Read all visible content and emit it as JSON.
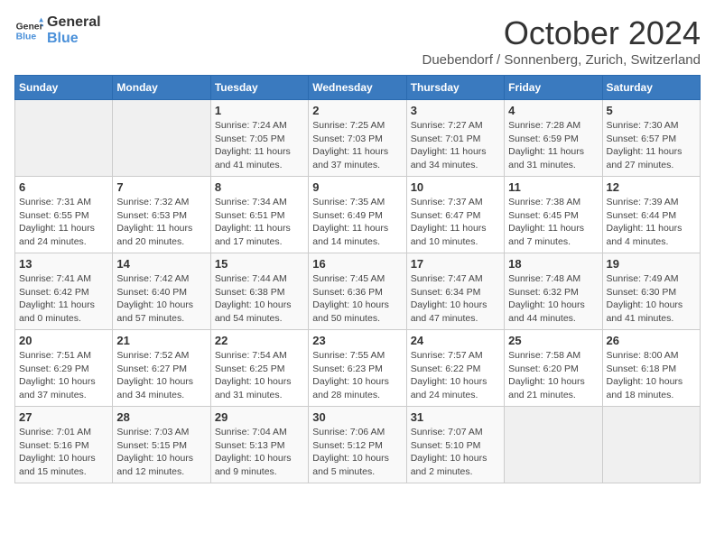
{
  "header": {
    "logo_general": "General",
    "logo_blue": "Blue",
    "title": "October 2024",
    "location": "Duebendorf / Sonnenberg, Zurich, Switzerland"
  },
  "weekdays": [
    "Sunday",
    "Monday",
    "Tuesday",
    "Wednesday",
    "Thursday",
    "Friday",
    "Saturday"
  ],
  "weeks": [
    [
      {
        "day": "",
        "empty": true
      },
      {
        "day": "",
        "empty": true
      },
      {
        "day": "1",
        "sunrise": "7:24 AM",
        "sunset": "7:05 PM",
        "daylight": "11 hours and 41 minutes."
      },
      {
        "day": "2",
        "sunrise": "7:25 AM",
        "sunset": "7:03 PM",
        "daylight": "11 hours and 37 minutes."
      },
      {
        "day": "3",
        "sunrise": "7:27 AM",
        "sunset": "7:01 PM",
        "daylight": "11 hours and 34 minutes."
      },
      {
        "day": "4",
        "sunrise": "7:28 AM",
        "sunset": "6:59 PM",
        "daylight": "11 hours and 31 minutes."
      },
      {
        "day": "5",
        "sunrise": "7:30 AM",
        "sunset": "6:57 PM",
        "daylight": "11 hours and 27 minutes."
      }
    ],
    [
      {
        "day": "6",
        "sunrise": "7:31 AM",
        "sunset": "6:55 PM",
        "daylight": "11 hours and 24 minutes."
      },
      {
        "day": "7",
        "sunrise": "7:32 AM",
        "sunset": "6:53 PM",
        "daylight": "11 hours and 20 minutes."
      },
      {
        "day": "8",
        "sunrise": "7:34 AM",
        "sunset": "6:51 PM",
        "daylight": "11 hours and 17 minutes."
      },
      {
        "day": "9",
        "sunrise": "7:35 AM",
        "sunset": "6:49 PM",
        "daylight": "11 hours and 14 minutes."
      },
      {
        "day": "10",
        "sunrise": "7:37 AM",
        "sunset": "6:47 PM",
        "daylight": "11 hours and 10 minutes."
      },
      {
        "day": "11",
        "sunrise": "7:38 AM",
        "sunset": "6:45 PM",
        "daylight": "11 hours and 7 minutes."
      },
      {
        "day": "12",
        "sunrise": "7:39 AM",
        "sunset": "6:44 PM",
        "daylight": "11 hours and 4 minutes."
      }
    ],
    [
      {
        "day": "13",
        "sunrise": "7:41 AM",
        "sunset": "6:42 PM",
        "daylight": "11 hours and 0 minutes."
      },
      {
        "day": "14",
        "sunrise": "7:42 AM",
        "sunset": "6:40 PM",
        "daylight": "10 hours and 57 minutes."
      },
      {
        "day": "15",
        "sunrise": "7:44 AM",
        "sunset": "6:38 PM",
        "daylight": "10 hours and 54 minutes."
      },
      {
        "day": "16",
        "sunrise": "7:45 AM",
        "sunset": "6:36 PM",
        "daylight": "10 hours and 50 minutes."
      },
      {
        "day": "17",
        "sunrise": "7:47 AM",
        "sunset": "6:34 PM",
        "daylight": "10 hours and 47 minutes."
      },
      {
        "day": "18",
        "sunrise": "7:48 AM",
        "sunset": "6:32 PM",
        "daylight": "10 hours and 44 minutes."
      },
      {
        "day": "19",
        "sunrise": "7:49 AM",
        "sunset": "6:30 PM",
        "daylight": "10 hours and 41 minutes."
      }
    ],
    [
      {
        "day": "20",
        "sunrise": "7:51 AM",
        "sunset": "6:29 PM",
        "daylight": "10 hours and 37 minutes."
      },
      {
        "day": "21",
        "sunrise": "7:52 AM",
        "sunset": "6:27 PM",
        "daylight": "10 hours and 34 minutes."
      },
      {
        "day": "22",
        "sunrise": "7:54 AM",
        "sunset": "6:25 PM",
        "daylight": "10 hours and 31 minutes."
      },
      {
        "day": "23",
        "sunrise": "7:55 AM",
        "sunset": "6:23 PM",
        "daylight": "10 hours and 28 minutes."
      },
      {
        "day": "24",
        "sunrise": "7:57 AM",
        "sunset": "6:22 PM",
        "daylight": "10 hours and 24 minutes."
      },
      {
        "day": "25",
        "sunrise": "7:58 AM",
        "sunset": "6:20 PM",
        "daylight": "10 hours and 21 minutes."
      },
      {
        "day": "26",
        "sunrise": "8:00 AM",
        "sunset": "6:18 PM",
        "daylight": "10 hours and 18 minutes."
      }
    ],
    [
      {
        "day": "27",
        "sunrise": "7:01 AM",
        "sunset": "5:16 PM",
        "daylight": "10 hours and 15 minutes."
      },
      {
        "day": "28",
        "sunrise": "7:03 AM",
        "sunset": "5:15 PM",
        "daylight": "10 hours and 12 minutes."
      },
      {
        "day": "29",
        "sunrise": "7:04 AM",
        "sunset": "5:13 PM",
        "daylight": "10 hours and 9 minutes."
      },
      {
        "day": "30",
        "sunrise": "7:06 AM",
        "sunset": "5:12 PM",
        "daylight": "10 hours and 5 minutes."
      },
      {
        "day": "31",
        "sunrise": "7:07 AM",
        "sunset": "5:10 PM",
        "daylight": "10 hours and 2 minutes."
      },
      {
        "day": "",
        "empty": true
      },
      {
        "day": "",
        "empty": true
      }
    ]
  ],
  "labels": {
    "sunrise": "Sunrise:",
    "sunset": "Sunset:",
    "daylight": "Daylight:"
  }
}
